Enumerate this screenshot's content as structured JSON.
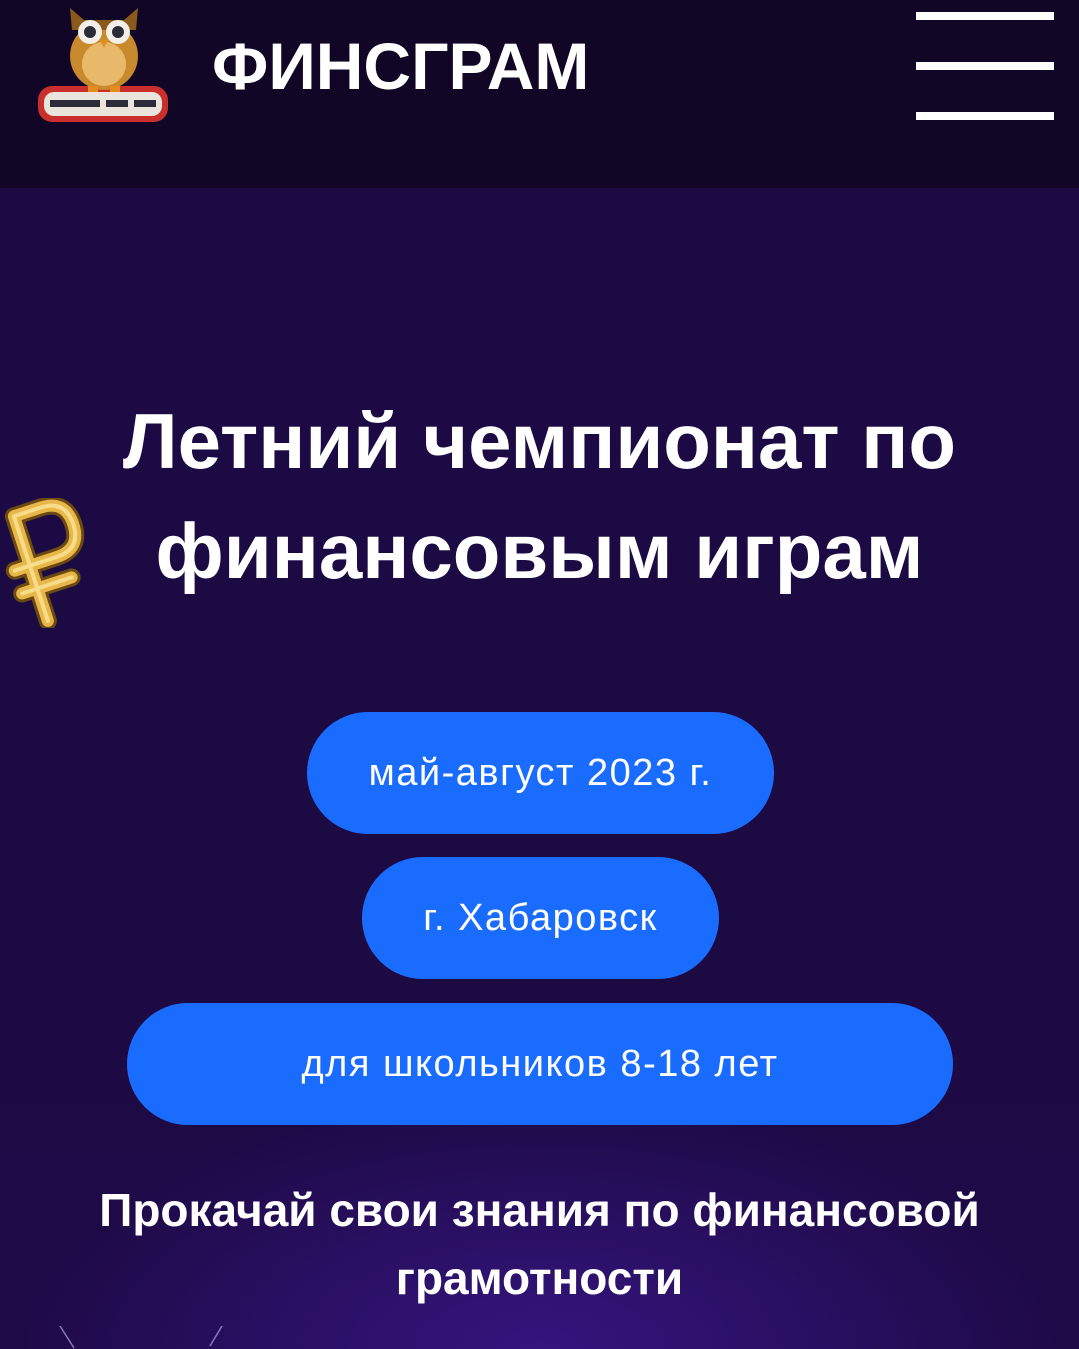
{
  "header": {
    "brand": "ФИНСГРАМ",
    "logo_icon": "owl-on-books-icon",
    "menu_icon": "hamburger-menu-icon"
  },
  "hero": {
    "title_line1": "Летний чемпионат по",
    "title_line2": "финансовым играм",
    "decoration_icon": "ruble-sign-icon",
    "pills": [
      {
        "label": "май-август 2023 г."
      },
      {
        "label": "г. Хабаровск"
      },
      {
        "label": "для школьников 8-18 лет"
      }
    ],
    "subtitle_line1": "Прокачай свои знания по финансовой",
    "subtitle_line2": "грамотности"
  },
  "colors": {
    "header_bg": "#110626",
    "page_bg": "#1c0940",
    "pill_bg": "#1a6cff",
    "text": "#ffffff",
    "ruble_gold": "#e8b74a"
  }
}
